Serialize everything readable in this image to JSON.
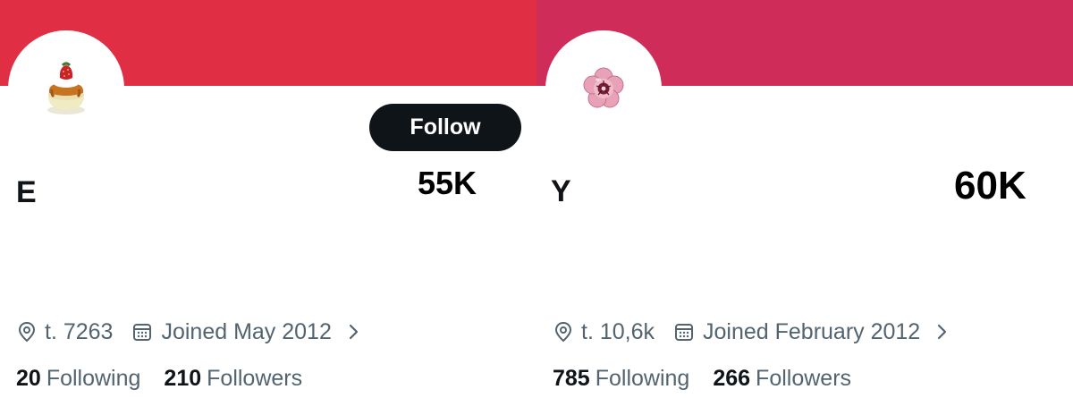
{
  "profiles": [
    {
      "banner_color": "#e02f44",
      "avatar_icon": "flan-pudding-icon",
      "initial": "E",
      "count": "55K",
      "follow_label": "Follow",
      "location": "t. 7263",
      "joined": "Joined May 2012",
      "following_count": "20",
      "following_label": "Following",
      "followers_count": "210",
      "followers_label": "Followers"
    },
    {
      "banner_color": "#d02c59",
      "avatar_icon": "pink-flower-icon",
      "initial": "Y",
      "count": "60K",
      "location": "t. 10,6k",
      "joined": "Joined February 2012",
      "following_count": "785",
      "following_label": "Following",
      "followers_count": "266",
      "followers_label": "Followers"
    }
  ],
  "colors": {
    "text_primary": "#0f1419",
    "text_secondary": "#536471",
    "button_bg": "#0f1419"
  },
  "icons": {
    "location": "location-pin-icon",
    "calendar": "calendar-icon",
    "chevron": "chevron-right-icon"
  }
}
